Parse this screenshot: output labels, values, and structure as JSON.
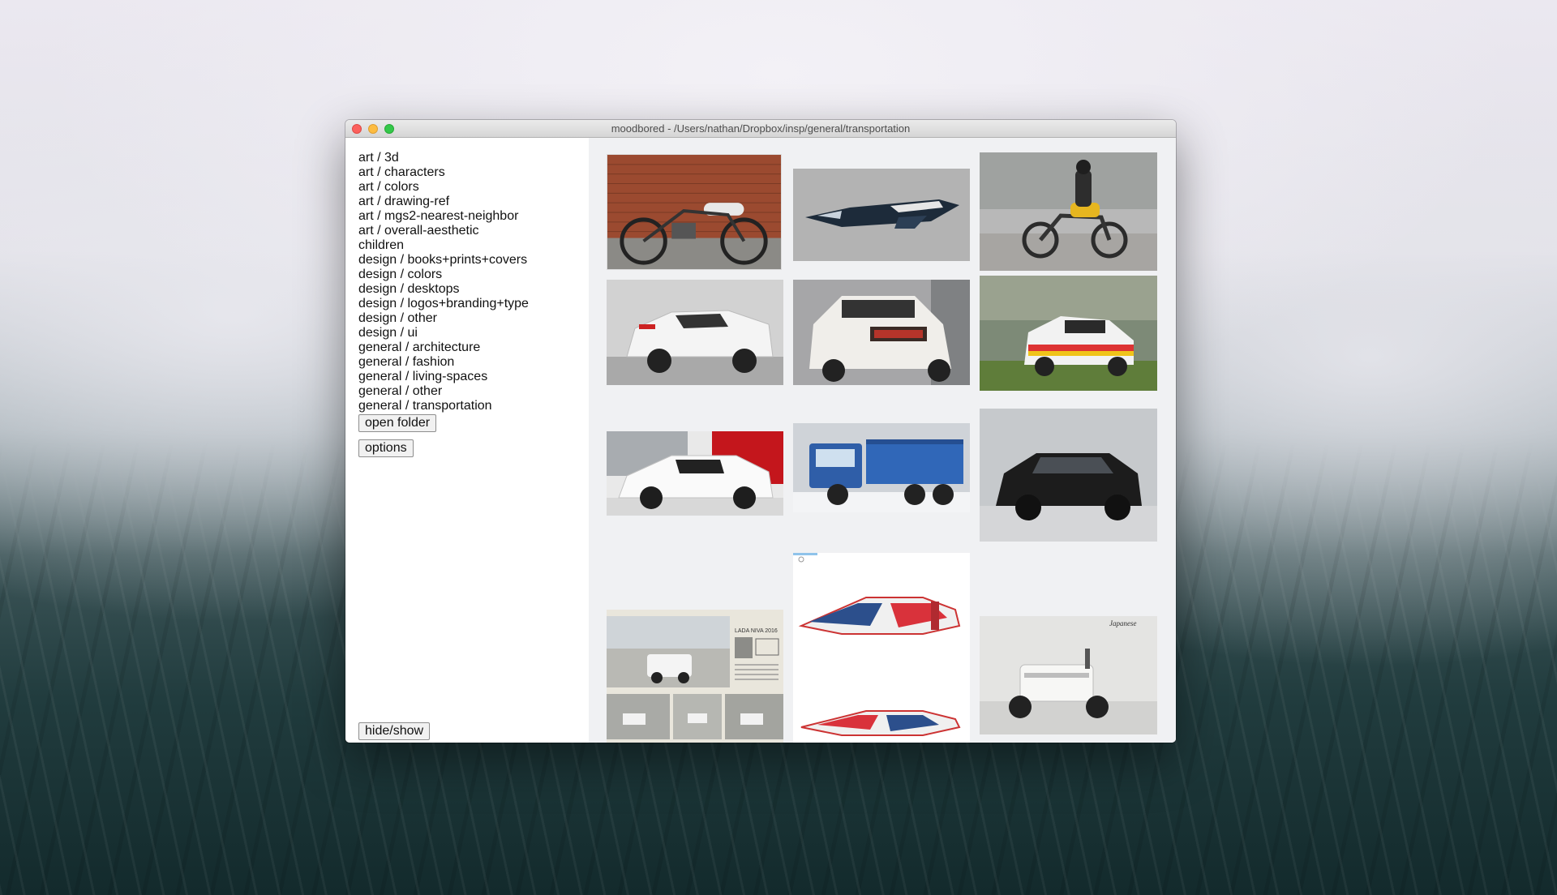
{
  "window": {
    "title": "moodbored - /Users/nathan/Dropbox/insp/general/transportation"
  },
  "sidebar": {
    "folders": [
      "art / 3d",
      "art / characters",
      "art / colors",
      "art / drawing-ref",
      "art / mgs2-nearest-neighbor",
      "art / overall-aesthetic",
      "children",
      "design / books+prints+covers",
      "design / colors",
      "design / desktops",
      "design / logos+branding+type",
      "design / other",
      "design / ui",
      "general / architecture",
      "general / fashion",
      "general / living-spaces",
      "general / other",
      "general / transportation"
    ],
    "open_folder_label": "open folder",
    "options_label": "options",
    "hide_show_label": "hide/show"
  },
  "gallery": {
    "images": [
      {
        "subject": "cafe racer moped against brick wall"
      },
      {
        "subject": "futuristic spaceship render"
      },
      {
        "subject": "rider on yellow motorcycle in fog"
      },
      {
        "subject": "white toyota rally prototype"
      },
      {
        "subject": "white rally car rear view"
      },
      {
        "subject": "audi quattro rally car"
      },
      {
        "subject": "white ford rs200 rally car"
      },
      {
        "subject": "blue dump truck in snow"
      },
      {
        "subject": "black hatchback"
      },
      {
        "subject": "lada niva magazine page",
        "text": "LADA NIVA 2016"
      },
      {
        "subject": "spaceship concept sketches"
      },
      {
        "subject": "white folding scooter",
        "text": "Japanese"
      }
    ]
  },
  "colors": {
    "close": "#fc605c",
    "minimize": "#fdbc40",
    "maximize": "#34c84a",
    "gallery_bg": "#f0f1f3"
  }
}
